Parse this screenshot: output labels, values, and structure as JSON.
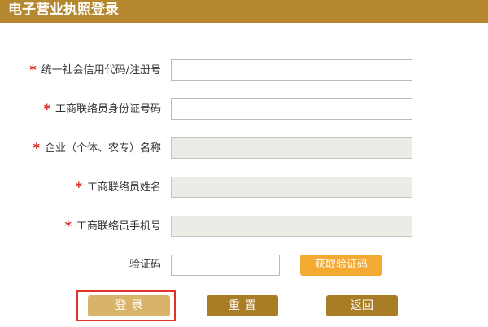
{
  "header": {
    "title": "电子营业执照登录"
  },
  "form": {
    "required_mark": "*",
    "credit_code": {
      "label": "统一社会信用代码/注册号",
      "value": ""
    },
    "liaison_id": {
      "label": "工商联络员身份证号码",
      "value": ""
    },
    "company_name": {
      "label": "企业（个体、农专）名称",
      "value": ""
    },
    "liaison_name": {
      "label": "工商联络员姓名",
      "value": ""
    },
    "liaison_phone": {
      "label": "工商联络员手机号",
      "value": ""
    },
    "verification": {
      "label": "验证码",
      "value": "",
      "get_code_label": "获取验证码"
    }
  },
  "actions": {
    "login_label": "登录",
    "reset_label": "重置",
    "back_label": "返回"
  },
  "colors": {
    "header_bg": "#b5872f",
    "required_star": "#d8261e",
    "get_code_button": "#f4aa32",
    "login_button": "#d8b36a",
    "dark_buttons": "#a97c26",
    "highlight_border": "#e0332c",
    "disabled_field": "#ecebe6"
  }
}
